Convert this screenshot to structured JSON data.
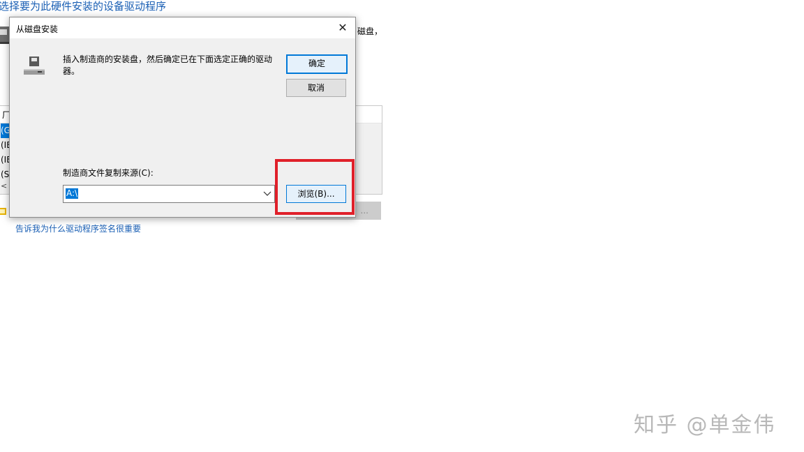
{
  "background": {
    "title": "选择要为此硬件安装的设备驱动程序",
    "desc_fragment": "磁盘，",
    "list_header": "厂",
    "list_rows": [
      "(G",
      "(IE",
      "(IE",
      "(St"
    ],
    "ghost_button_label": "...",
    "link_text": "告诉我为什么驱动程序签名很重要"
  },
  "dialog": {
    "title": "从磁盘安装",
    "close_symbol": "✕",
    "icon": "floppy-drive-icon",
    "message": "插入制造商的安装盘，然后确定已在下面选定正确的驱动器。",
    "ok_label": "确定",
    "cancel_label": "取消",
    "source_label": "制造商文件复制来源(C):",
    "source_value": "A:\\",
    "browse_label": "浏览(B)..."
  },
  "colors": {
    "accent": "#0078d7",
    "highlight": "#e0202a",
    "link": "#1a5fb4"
  },
  "watermark": "知乎 @单金伟"
}
